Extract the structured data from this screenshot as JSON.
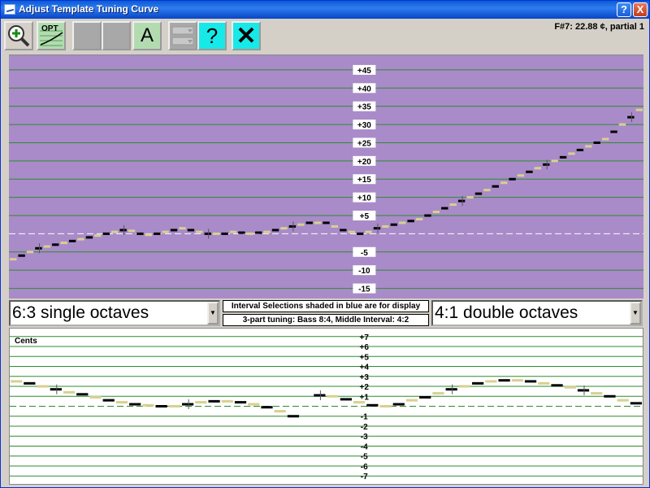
{
  "window": {
    "title": "Adjust Template Tuning Curve",
    "help_glyph": "?",
    "close_glyph": "X"
  },
  "toolbar": {
    "zoom_icon": "zoom-in-icon",
    "opt_label": "OPT",
    "a_label": "A",
    "help_label": "?",
    "close_label": "✕"
  },
  "status": {
    "note_readout": "F#7: 22.88 ¢, partial 1"
  },
  "top_chart": {
    "ticks": [
      "+45",
      "+40",
      "+35",
      "+30",
      "+25",
      "+20",
      "+15",
      "+10",
      "+5",
      "-5",
      "-10",
      "-15"
    ],
    "tick_values": [
      45,
      40,
      35,
      30,
      25,
      20,
      15,
      10,
      5,
      -5,
      -10,
      -15
    ],
    "ylim": [
      -18,
      49
    ],
    "colors": {
      "background": "#a98bc9",
      "grid": "#2e8b2e",
      "dark_mark": "#000000",
      "light_mark": "#d8d090"
    }
  },
  "selectors": {
    "left_value": "6:3 single octaves",
    "right_value": "4:1 double octaves",
    "info_line_1": "Interval Selections shaded in blue are for display",
    "info_line_2": "3-part tuning: Bass 8:4, Middle Interval: 4:2"
  },
  "bottom_chart": {
    "axis_label": "Cents",
    "ticks": [
      "+7",
      "+6",
      "+5",
      "+4",
      "+3",
      "+2",
      "+1",
      "-1",
      "-2",
      "-3",
      "-4",
      "-5",
      "-6",
      "-7"
    ],
    "tick_values": [
      7,
      6,
      5,
      4,
      3,
      2,
      1,
      -1,
      -2,
      -3,
      -4,
      -5,
      -6,
      -7
    ],
    "ylim": [
      -7.8,
      7.8
    ]
  },
  "chart_data": [
    {
      "type": "scatter",
      "title": "",
      "xlabel": "",
      "ylabel": "",
      "ylim": [
        -18,
        49
      ],
      "grid": true,
      "series": [
        {
          "values": [
            -7,
            -6,
            -5,
            -4,
            -3.5,
            -3,
            -2.5,
            -2,
            -1.5,
            -1,
            -0.5,
            0,
            0.5,
            1,
            0.8,
            0,
            -0.3,
            0,
            0.5,
            1,
            1.5,
            1,
            0.5,
            0,
            0,
            0,
            0.5,
            0.3,
            0,
            0.3,
            0.5,
            1,
            1.5,
            2,
            2.5,
            3,
            3,
            3,
            2,
            1,
            0.5,
            0,
            0.5,
            1.5,
            2,
            2.5,
            3,
            3.5,
            4,
            5,
            6,
            7,
            8,
            9,
            10,
            11,
            12,
            13,
            14,
            15,
            16,
            17,
            18,
            19,
            20,
            21,
            22,
            23,
            24,
            25,
            26,
            28,
            30,
            32,
            34
          ]
        }
      ]
    },
    {
      "type": "scatter",
      "title": "",
      "xlabel": "",
      "ylabel": "Cents",
      "ylim": [
        -7.8,
        7.8
      ],
      "grid": true,
      "series": [
        {
          "values": [
            2.5,
            2.3,
            2,
            1.7,
            1.4,
            1.2,
            0.9,
            0.6,
            0.4,
            0.2,
            0.1,
            0,
            0,
            0.2,
            0.4,
            0.5,
            0.5,
            0.4,
            0.2,
            -0.1,
            -0.5,
            -1,
            null,
            1.1,
            1,
            0.7,
            0.4,
            0.1,
            0,
            0.2,
            0.6,
            0.9,
            1.3,
            1.7,
            2,
            2.3,
            2.5,
            2.6,
            2.6,
            2.5,
            2.3,
            2.1,
            1.9,
            1.6,
            1.3,
            1,
            0.6,
            0.3
          ]
        }
      ]
    }
  ]
}
